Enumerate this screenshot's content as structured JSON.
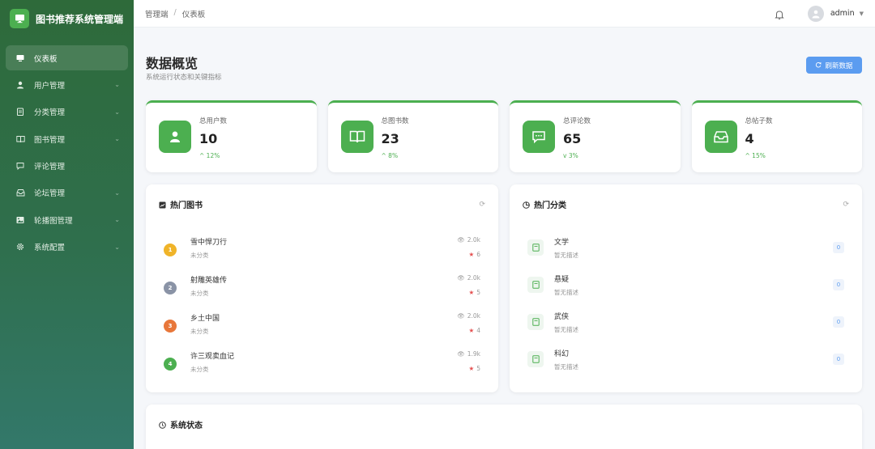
{
  "app": {
    "title": "图书推荐系统管理端"
  },
  "sidebar": {
    "items": [
      {
        "label": "仪表板",
        "icon": "monitor-icon"
      },
      {
        "label": "用户管理",
        "icon": "user-icon"
      },
      {
        "label": "分类管理",
        "icon": "clipboard-icon"
      },
      {
        "label": "图书管理",
        "icon": "book-open-icon"
      },
      {
        "label": "评论管理",
        "icon": "comment-icon"
      },
      {
        "label": "论坛管理",
        "icon": "inbox-icon"
      },
      {
        "label": "轮播图管理",
        "icon": "picture-icon"
      },
      {
        "label": "系统配置",
        "icon": "gear-icon"
      }
    ]
  },
  "header": {
    "breadcrumb": [
      "管理端",
      "/",
      "仪表板"
    ],
    "username": "admin"
  },
  "page": {
    "title": "数据概览",
    "subtitle": "系统运行状态和关键指标",
    "refresh_label": "刷新数据"
  },
  "stats": [
    {
      "label": "总用户数",
      "value": "10",
      "trend": "^ 12%",
      "icon": "user-icon"
    },
    {
      "label": "总图书数",
      "value": "23",
      "trend": "^ 8%",
      "icon": "book-open-icon"
    },
    {
      "label": "总评论数",
      "value": "65",
      "trend": "v 3%",
      "icon": "comment-icon"
    },
    {
      "label": "总帖子数",
      "value": "4",
      "trend": "^ 15%",
      "icon": "inbox-icon"
    }
  ],
  "hot_books": {
    "title": "热门图书",
    "items": [
      {
        "rank": "1",
        "title": "雪中悍刀行",
        "category": "未分类",
        "views": "2.0k",
        "favorites": "6",
        "color": "#f0b429"
      },
      {
        "rank": "2",
        "title": "射雕英雄传",
        "category": "未分类",
        "views": "2.0k",
        "favorites": "5",
        "color": "#8a93a6"
      },
      {
        "rank": "3",
        "title": "乡土中国",
        "category": "未分类",
        "views": "2.0k",
        "favorites": "4",
        "color": "#e8773a"
      },
      {
        "rank": "4",
        "title": "许三观卖血记",
        "category": "未分类",
        "views": "1.9k",
        "favorites": "5",
        "color": "#4caf50"
      }
    ]
  },
  "hot_categories": {
    "title": "热门分类",
    "items": [
      {
        "name": "文学",
        "desc": "暂无描述",
        "count": "0"
      },
      {
        "name": "悬疑",
        "desc": "暂无描述",
        "count": "0"
      },
      {
        "name": "武侠",
        "desc": "暂无描述",
        "count": "0"
      },
      {
        "name": "科幻",
        "desc": "暂无描述",
        "count": "0"
      }
    ]
  },
  "system_status": {
    "title": "系统状态"
  },
  "colors": {
    "accent": "#4caf50",
    "primary_button": "#5b9cf0",
    "sidebar_top": "#2e6a3a",
    "sidebar_bottom": "#33786a"
  }
}
